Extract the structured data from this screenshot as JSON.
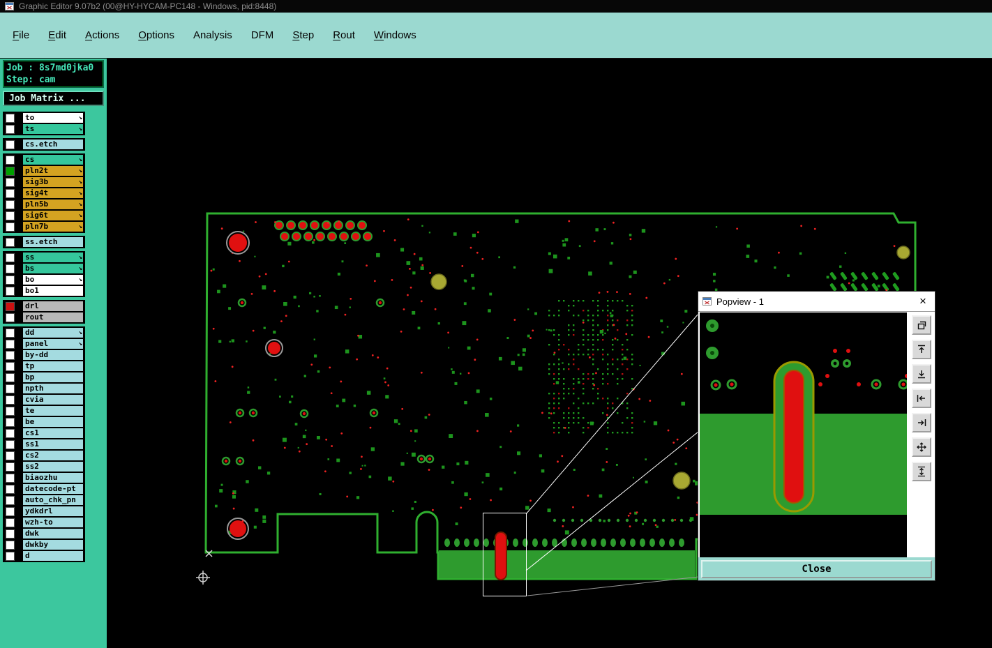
{
  "window": {
    "title": "Graphic Editor 9.07b2 (00@HY-HYCAM-PC148 - Windows, pid:8448)"
  },
  "menubar": {
    "items": [
      {
        "label": "File",
        "u": 0
      },
      {
        "label": "Edit",
        "u": 0
      },
      {
        "label": "Actions",
        "u": 0
      },
      {
        "label": "Options",
        "u": 0
      },
      {
        "label": "Analysis",
        "u": -1
      },
      {
        "label": "DFM",
        "u": -1
      },
      {
        "label": "Step",
        "u": 0
      },
      {
        "label": "Rout",
        "u": 0
      },
      {
        "label": "Windows",
        "u": 0
      }
    ]
  },
  "sidebar": {
    "job_label": "Job : 8s7md0jka0",
    "step_label": "Step: cam",
    "job_matrix_button": "Job Matrix ...",
    "layer_groups": [
      {
        "rows": [
          {
            "label": "to",
            "color": "white",
            "arrow": true,
            "check": "empty"
          },
          {
            "label": "ts",
            "color": "teal",
            "arrow": true,
            "check": "empty"
          }
        ]
      },
      {
        "rows": [
          {
            "label": "cs.etch",
            "color": "cyan",
            "arrow": false,
            "check": "empty"
          }
        ]
      },
      {
        "rows": [
          {
            "label": "cs",
            "color": "teal",
            "arrow": true,
            "check": "empty"
          },
          {
            "label": "pln2t",
            "color": "gold",
            "arrow": true,
            "check": "green"
          },
          {
            "label": "sig3b",
            "color": "gold",
            "arrow": true,
            "check": "empty"
          },
          {
            "label": "sig4t",
            "color": "gold",
            "arrow": true,
            "check": "empty"
          },
          {
            "label": "pln5b",
            "color": "gold",
            "arrow": true,
            "check": "empty"
          },
          {
            "label": "sig6t",
            "color": "gold",
            "arrow": true,
            "check": "empty"
          },
          {
            "label": "pln7b",
            "color": "gold",
            "arrow": true,
            "check": "empty"
          }
        ]
      },
      {
        "rows": [
          {
            "label": "ss.etch",
            "color": "cyan",
            "arrow": false,
            "check": "empty"
          }
        ]
      },
      {
        "rows": [
          {
            "label": "ss",
            "color": "teal",
            "arrow": true,
            "check": "empty"
          },
          {
            "label": "bs",
            "color": "teal",
            "arrow": true,
            "check": "empty"
          },
          {
            "label": "bo",
            "color": "white",
            "arrow": true,
            "check": "empty"
          },
          {
            "label": "bo1",
            "color": "white",
            "arrow": false,
            "check": "empty"
          }
        ]
      },
      {
        "rows": [
          {
            "label": "drl",
            "color": "gray",
            "arrow": false,
            "check": "red"
          },
          {
            "label": "rout",
            "color": "gray",
            "arrow": false,
            "check": "empty"
          }
        ]
      },
      {
        "rows": [
          {
            "label": "dd",
            "color": "cyan",
            "arrow": true,
            "check": "empty"
          },
          {
            "label": "panel",
            "color": "cyan",
            "arrow": true,
            "check": "empty"
          },
          {
            "label": "by-dd",
            "color": "cyan",
            "arrow": false,
            "check": "empty"
          },
          {
            "label": "tp",
            "color": "cyan",
            "arrow": false,
            "check": "empty"
          },
          {
            "label": "bp",
            "color": "cyan",
            "arrow": false,
            "check": "empty"
          },
          {
            "label": "npth",
            "color": "cyan",
            "arrow": false,
            "check": "empty"
          },
          {
            "label": "cvia",
            "color": "cyan",
            "arrow": false,
            "check": "empty"
          },
          {
            "label": "te",
            "color": "cyan",
            "arrow": false,
            "check": "empty"
          },
          {
            "label": "be",
            "color": "cyan",
            "arrow": false,
            "check": "empty"
          },
          {
            "label": "cs1",
            "color": "cyan",
            "arrow": false,
            "check": "empty"
          },
          {
            "label": "ss1",
            "color": "cyan",
            "arrow": false,
            "check": "empty"
          },
          {
            "label": "cs2",
            "color": "cyan",
            "arrow": false,
            "check": "empty"
          },
          {
            "label": "ss2",
            "color": "cyan",
            "arrow": false,
            "check": "empty"
          },
          {
            "label": "biaozhu",
            "color": "cyan",
            "arrow": false,
            "check": "empty"
          },
          {
            "label": "datecode-pt",
            "color": "cyan",
            "arrow": false,
            "check": "empty"
          },
          {
            "label": "auto_chk_pn",
            "color": "cyan",
            "arrow": false,
            "check": "empty"
          },
          {
            "label": "ydkdrl",
            "color": "cyan",
            "arrow": false,
            "check": "empty"
          },
          {
            "label": "wzh-to",
            "color": "cyan",
            "arrow": false,
            "check": "empty"
          },
          {
            "label": "dwk",
            "color": "cyan",
            "arrow": false,
            "check": "empty"
          },
          {
            "label": "dwkby",
            "color": "cyan",
            "arrow": false,
            "check": "empty"
          },
          {
            "label": "d",
            "color": "cyan",
            "arrow": false,
            "check": "empty"
          }
        ]
      }
    ]
  },
  "popview": {
    "title": "Popview - 1",
    "close_glyph": "×",
    "close_button": "Close",
    "tool_icons": [
      "restore-icon",
      "scroll-up-icon",
      "scroll-down-icon",
      "scroll-left-icon",
      "scroll-right-icon",
      "move-icon",
      "vertical-scroll-icon"
    ]
  },
  "colors": {
    "menubar_teal": "#9bd9d0",
    "sidebar_teal": "#3cc79e",
    "layer": {
      "white": "#ffffff",
      "teal": "#35c79c",
      "gold": "#d4a321",
      "cyan": "#a4dbe0",
      "gray": "#b8b8b8"
    },
    "check_red": "#cc1111",
    "check_green": "#00a000",
    "pcb": {
      "outline": "#2faf2f",
      "copper": "#2e9b2e",
      "dot_green": "#1f9c1f",
      "pad_red": "#e01010",
      "pad_olive": "#a8a832",
      "ring_gray": "#999999"
    }
  }
}
